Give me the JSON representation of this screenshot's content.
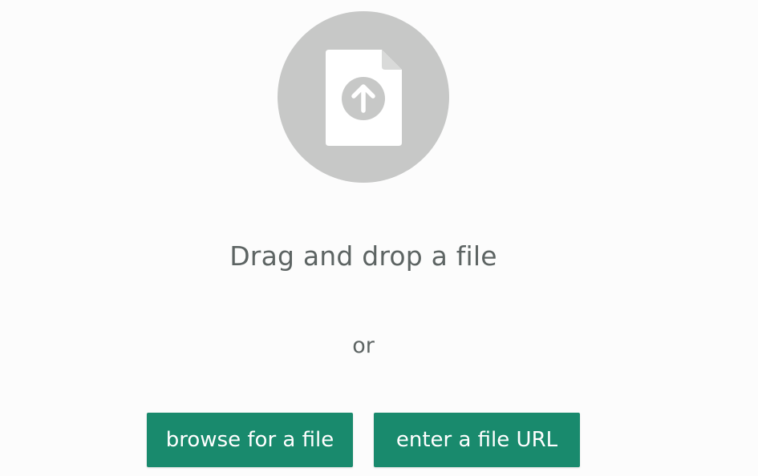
{
  "upload": {
    "icon": "file-upload-icon",
    "headline": "Drag and drop a file",
    "separator": "or",
    "browse_label": "browse for a file",
    "url_label": "enter a file URL"
  },
  "colors": {
    "background": "#fcfcfc",
    "circle": "#c7c8c7",
    "text": "#5d6463",
    "button": "#198a6d",
    "button_text": "#ffffff"
  }
}
